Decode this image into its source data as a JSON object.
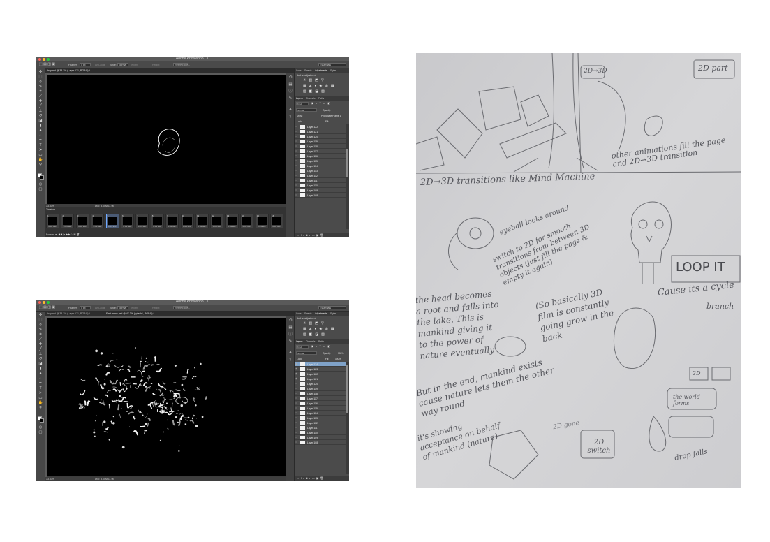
{
  "photoshop": {
    "app_title": "Adobe Photoshop CC",
    "options": {
      "feather_label": "Feather:",
      "feather_value": "0 px",
      "anti_alias": "Anti-alias",
      "style_label": "Style:",
      "style_value": "Normal",
      "width_label": "Width:",
      "height_label": "Height:",
      "refine_edge": "Refine Edge...",
      "workspace": "Essentials"
    },
    "panels": {
      "top_tabs": [
        "Color",
        "Swatch",
        "Adjustments",
        "Styles"
      ],
      "active_top_tab": "Adjustments",
      "add_adjustment": "Add an adjustment",
      "layer_tabs": [
        "Layers",
        "Channels",
        "Paths"
      ],
      "kind": "Kind",
      "blend_mode": "Normal",
      "opacity_label": "Opacity:",
      "lock_label": "Lock:",
      "fill_label": "Fill:",
      "unify_label": "Unify:",
      "propagate": "Propagate Frame 1"
    },
    "window1": {
      "tab": "dropand @ 33.3% (Layer 121, RGB/8) *",
      "zoom": "33.33%",
      "doc": "Doc: 3.00M/11.9M",
      "timeline_title": "Timeline",
      "frames": [
        {
          "num": "1",
          "delay": "0.04 sec."
        },
        {
          "num": "2",
          "delay": "0.04 sec."
        },
        {
          "num": "3",
          "delay": "0.04 sec."
        },
        {
          "num": "4",
          "delay": "0.04 sec."
        },
        {
          "num": "5",
          "delay": "0.04 sec."
        },
        {
          "num": "6",
          "delay": "0.04 sec."
        },
        {
          "num": "7",
          "delay": "0.04 sec."
        },
        {
          "num": "8",
          "delay": "0.04 sec."
        },
        {
          "num": "9",
          "delay": "0.04 sec."
        },
        {
          "num": "10",
          "delay": "0.04 sec."
        },
        {
          "num": "11",
          "delay": "0.04 sec."
        },
        {
          "num": "12",
          "delay": "0.04 sec."
        },
        {
          "num": "13",
          "delay": "0.04 sec."
        },
        {
          "num": "14",
          "delay": "0.04 sec."
        },
        {
          "num": "15",
          "delay": "0.04 sec."
        },
        {
          "num": "16",
          "delay": "0.04 sec."
        }
      ],
      "selected_frame": 5,
      "loop": "Forever",
      "layers": [
        "Layer 122",
        "Layer 121",
        "Layer 120",
        "Layer 119",
        "Layer 118",
        "Layer 117",
        "Layer 116",
        "Layer 115",
        "Layer 114",
        "Layer 113",
        "Layer 112",
        "Layer 111",
        "Layer 110",
        "Layer 109",
        "Layer 108"
      ],
      "opacity": "100%",
      "fill": "100%"
    },
    "window2": {
      "tab": "dropand @ 33.3% (Layer 121, RGB/8) *",
      "tab2": "First frame.psd @ 47.3% (splash1, RGB/8) *",
      "zoom": "33.33%",
      "doc": "Doc: 3.00M/11.9M",
      "layers": [
        "Layer 124",
        "Layer 123",
        "Layer 122",
        "Layer 121",
        "Layer 120",
        "Layer 119",
        "Layer 118",
        "Layer 117",
        "Layer 116",
        "Layer 115",
        "Layer 114",
        "Layer 113",
        "Layer 112",
        "Layer 111",
        "Layer 110",
        "Layer 109",
        "Layer 108"
      ],
      "opacity": "100%",
      "fill": "100%"
    }
  },
  "sketch": {
    "box_top_left": "2D→3D",
    "box_top_right": "2D part",
    "note_animations": "other animations fill the page and 2D→3D transition",
    "note_transitions": "2D→3D transitions like Mind Machine",
    "note_eyeball": "eyeball looks around",
    "note_switch": "switch to 2D for smooth transitions from between 3D objects (just fill the page & empty it again)",
    "box_loop": "LOOP IT",
    "note_cycle": "Cause its a cycle",
    "note_branch": "branch",
    "note_basically": "(So basically 3D film is constantly going grow in the back",
    "note_head": "the head becomes a root and falls into the lake. This is mankind giving it to the power of nature eventually",
    "note_end": "But in the end, mankind exists cause nature lets them the other way round",
    "note_accept": "it's showing acceptance on behalf of mankind (nature)",
    "box_2d_switch": "2D switch",
    "box_2d_small": "2D",
    "note_2d_gone": "2D gone",
    "note_drip": "drop falls",
    "note_right_box": "the world forms"
  }
}
